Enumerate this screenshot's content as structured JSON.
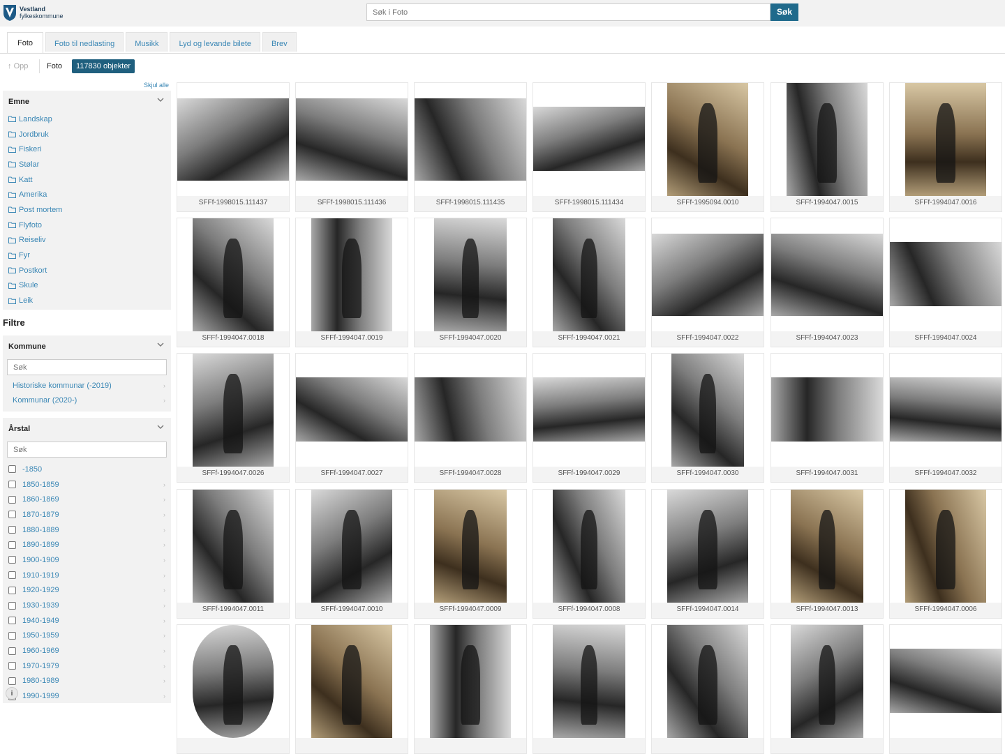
{
  "header": {
    "logo_line1": "Vestland",
    "logo_line2": "fylkeskommune",
    "search_placeholder": "Søk i Foto",
    "search_button": "Søk"
  },
  "tabs": [
    {
      "label": "Foto",
      "active": true
    },
    {
      "label": "Foto til nedlasting",
      "active": false
    },
    {
      "label": "Musikk",
      "active": false
    },
    {
      "label": "Lyd og levande bilete",
      "active": false
    },
    {
      "label": "Brev",
      "active": false
    }
  ],
  "toolbar": {
    "up_label": "Opp",
    "current": "Foto",
    "count": "117830 objekter"
  },
  "sidebar": {
    "hide_all": "Skjul alle",
    "emne_title": "Emne",
    "emne_items": [
      "Landskap",
      "Jordbruk",
      "Fiskeri",
      "Stølar",
      "Katt",
      "Amerika",
      "Post mortem",
      "Flyfoto",
      "Reiseliv",
      "Fyr",
      "Postkort",
      "Skule",
      "Leik"
    ],
    "filtre_title": "Filtre",
    "kommune_title": "Kommune",
    "kommune_search": "Søk",
    "kommune_items": [
      "Historiske kommunar (-2019)",
      "Kommunar (2020-)"
    ],
    "arstal_title": "Årstal",
    "arstal_search": "Søk",
    "arstal_items": [
      "-1850",
      "1850-1859",
      "1860-1869",
      "1870-1879",
      "1880-1889",
      "1890-1899",
      "1900-1909",
      "1910-1919",
      "1920-1929",
      "1930-1939",
      "1940-1949",
      "1950-1959",
      "1960-1969",
      "1970-1979",
      "1980-1989",
      "1990-1999"
    ]
  },
  "grid": {
    "items": [
      {
        "id": "SFFf-1998015.111437",
        "tone": "bw",
        "shape": "landscape"
      },
      {
        "id": "SFFf-1998015.111436",
        "tone": "bw",
        "shape": "landscape"
      },
      {
        "id": "SFFf-1998015.111435",
        "tone": "bw",
        "shape": "landscape"
      },
      {
        "id": "SFFf-1998015.111434",
        "tone": "bw",
        "shape": "wide"
      },
      {
        "id": "SFFf-1995094.0010",
        "tone": "sepia",
        "shape": "portrait"
      },
      {
        "id": "SFFf-1994047.0015",
        "tone": "bw",
        "shape": "portrait"
      },
      {
        "id": "SFFf-1994047.0016",
        "tone": "sepia",
        "shape": "portrait"
      },
      {
        "id": "SFFf-1994047.0018",
        "tone": "bw",
        "shape": "portrait"
      },
      {
        "id": "SFFf-1994047.0019",
        "tone": "bw",
        "shape": "portrait"
      },
      {
        "id": "SFFf-1994047.0020",
        "tone": "bw",
        "shape": "portrait-narrow"
      },
      {
        "id": "SFFf-1994047.0021",
        "tone": "bw",
        "shape": "portrait-narrow"
      },
      {
        "id": "SFFf-1994047.0022",
        "tone": "bw",
        "shape": "landscape"
      },
      {
        "id": "SFFf-1994047.0023",
        "tone": "bw",
        "shape": "landscape"
      },
      {
        "id": "SFFf-1994047.0024",
        "tone": "bw",
        "shape": "wide"
      },
      {
        "id": "SFFf-1994047.0026",
        "tone": "bw",
        "shape": "portrait"
      },
      {
        "id": "SFFf-1994047.0027",
        "tone": "bw",
        "shape": "wide"
      },
      {
        "id": "SFFf-1994047.0028",
        "tone": "bw",
        "shape": "wide"
      },
      {
        "id": "SFFf-1994047.0029",
        "tone": "bw",
        "shape": "wide"
      },
      {
        "id": "SFFf-1994047.0030",
        "tone": "bw",
        "shape": "portrait-narrow"
      },
      {
        "id": "SFFf-1994047.0031",
        "tone": "bw",
        "shape": "wide"
      },
      {
        "id": "SFFf-1994047.0032",
        "tone": "bw",
        "shape": "wide"
      },
      {
        "id": "SFFf-1994047.0011",
        "tone": "bw",
        "shape": "portrait"
      },
      {
        "id": "SFFf-1994047.0010",
        "tone": "bw",
        "shape": "portrait"
      },
      {
        "id": "SFFf-1994047.0009",
        "tone": "sepia",
        "shape": "portrait-narrow"
      },
      {
        "id": "SFFf-1994047.0008",
        "tone": "bw",
        "shape": "portrait-narrow"
      },
      {
        "id": "SFFf-1994047.0014",
        "tone": "bw",
        "shape": "portrait"
      },
      {
        "id": "SFFf-1994047.0013",
        "tone": "sepia",
        "shape": "portrait-narrow"
      },
      {
        "id": "SFFf-1994047.0006",
        "tone": "sepia",
        "shape": "portrait"
      },
      {
        "id": "",
        "tone": "bw",
        "shape": "portrait-oval"
      },
      {
        "id": "",
        "tone": "sepia",
        "shape": "portrait"
      },
      {
        "id": "",
        "tone": "bw",
        "shape": "portrait"
      },
      {
        "id": "",
        "tone": "bw",
        "shape": "portrait-narrow"
      },
      {
        "id": "",
        "tone": "bw",
        "shape": "portrait"
      },
      {
        "id": "",
        "tone": "bw",
        "shape": "portrait-narrow"
      },
      {
        "id": "",
        "tone": "bw",
        "shape": "wide"
      }
    ]
  },
  "colors": {
    "accent": "#1f6a8c",
    "link": "#3a87b5",
    "panel_bg": "#f2f2f2"
  }
}
